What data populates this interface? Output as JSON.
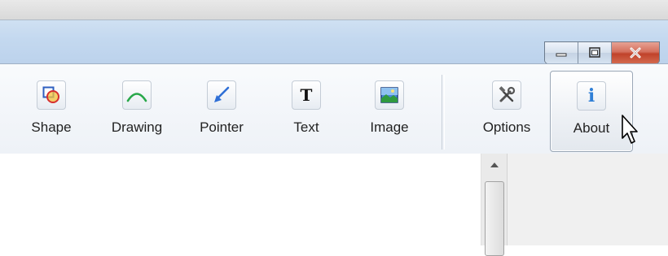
{
  "window": {
    "buttons": {
      "minimize_icon": "minimize-icon",
      "maximize_icon": "maximize-icon",
      "close_icon": "close-icon"
    }
  },
  "toolbar": {
    "items": [
      {
        "label": "Shape",
        "icon": "shape-icon"
      },
      {
        "label": "Drawing",
        "icon": "drawing-icon"
      },
      {
        "label": "Pointer",
        "icon": "pointer-icon"
      },
      {
        "label": "Text",
        "icon": "text-icon"
      },
      {
        "label": "Image",
        "icon": "image-icon"
      },
      {
        "label": "Options",
        "icon": "options-icon"
      },
      {
        "label": "About",
        "icon": "about-icon"
      }
    ],
    "text_icon_glyph": "T",
    "about_icon_glyph": "i"
  },
  "colors": {
    "close_red": "#c0422a",
    "accent_blue": "#2f7fd6",
    "drawing_green": "#29a84a"
  }
}
